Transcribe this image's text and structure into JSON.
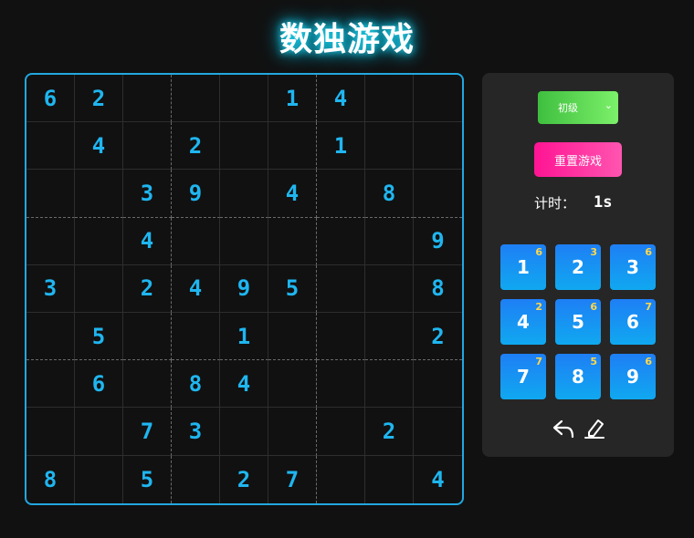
{
  "title": "数独游戏",
  "board": [
    [
      "6",
      "2",
      "",
      "",
      "",
      "1",
      "4",
      "",
      ""
    ],
    [
      "",
      "4",
      "",
      "2",
      "",
      "",
      "1",
      "",
      ""
    ],
    [
      "",
      "",
      "3",
      "9",
      "",
      "4",
      "",
      "8",
      ""
    ],
    [
      "",
      "",
      "4",
      "",
      "",
      "",
      "",
      "",
      "9"
    ],
    [
      "3",
      "",
      "2",
      "4",
      "9",
      "5",
      "",
      "",
      "8"
    ],
    [
      "",
      "5",
      "",
      "",
      "1",
      "",
      "",
      "",
      "2"
    ],
    [
      "",
      "6",
      "",
      "8",
      "4",
      "",
      "",
      "",
      ""
    ],
    [
      "",
      "",
      "7",
      "3",
      "",
      "",
      "",
      "2",
      ""
    ],
    [
      "8",
      "",
      "5",
      "",
      "2",
      "7",
      "",
      "",
      "4"
    ]
  ],
  "controls": {
    "level_selected": "初级",
    "reset_label": "重置游戏",
    "timer_label": "计时：",
    "timer_value": "1s"
  },
  "numpad": [
    {
      "digit": "1",
      "count": "6"
    },
    {
      "digit": "2",
      "count": "3"
    },
    {
      "digit": "3",
      "count": "6"
    },
    {
      "digit": "4",
      "count": "2"
    },
    {
      "digit": "5",
      "count": "6"
    },
    {
      "digit": "6",
      "count": "7"
    },
    {
      "digit": "7",
      "count": "7"
    },
    {
      "digit": "8",
      "count": "5"
    },
    {
      "digit": "9",
      "count": "6"
    }
  ],
  "tools": {
    "undo_icon": "undo-icon",
    "erase_icon": "eraser-icon"
  },
  "colors": {
    "accent": "#1fb6f0",
    "reset": "#ff1493",
    "level": "#4fd14a",
    "numpad": "#1e7ff5",
    "badge": "#ffd84a"
  }
}
